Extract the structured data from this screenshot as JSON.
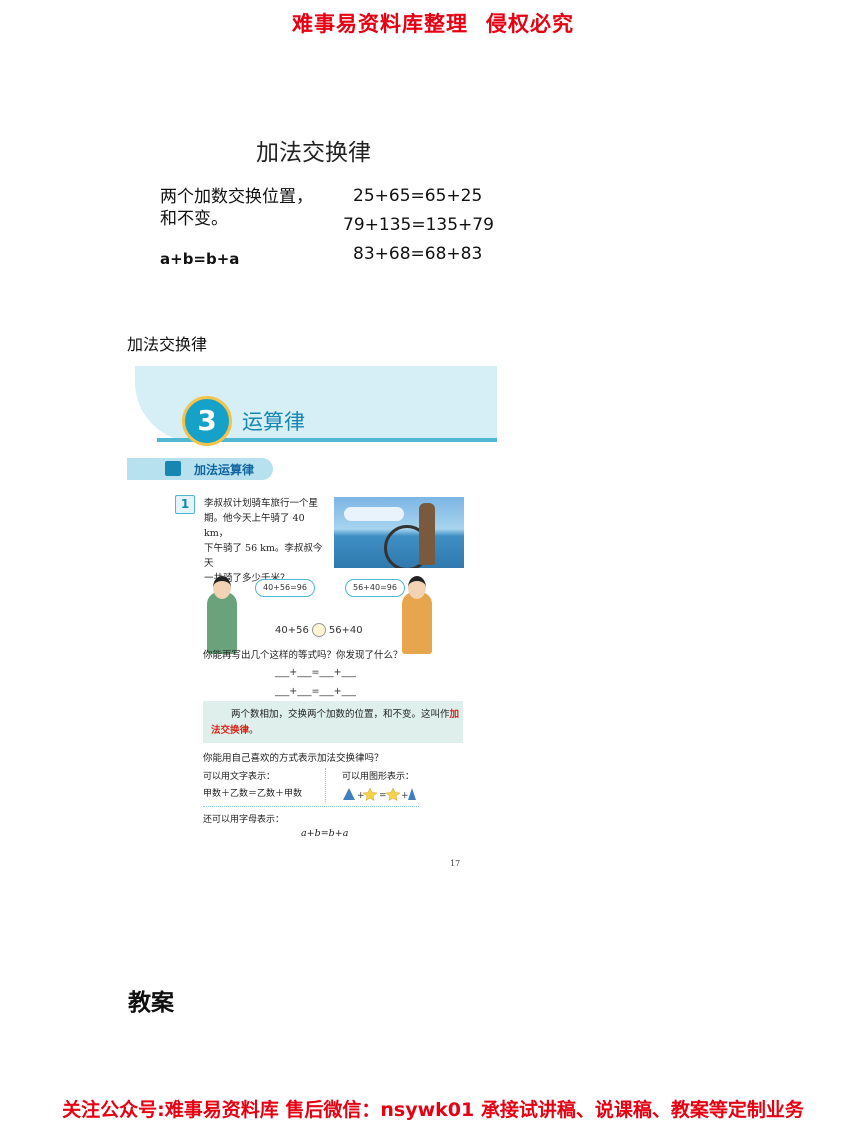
{
  "header": {
    "left": "难事易资料库整理",
    "right": "侵权必究"
  },
  "slide": {
    "title": "加法交换律",
    "rule_line1": "两个加数交换位置，",
    "rule_line2": "和不变。",
    "formula": "a+b=b+a",
    "equations": [
      "25+65=65+25",
      "79+135=135+79",
      "83+68=68+83"
    ]
  },
  "section_caption": "加法交换律",
  "textbook": {
    "unit_number": "3",
    "unit_title": "运算律",
    "topic": "加法运算律",
    "exercise_number": "1",
    "problem_lines": [
      "李叔叔计划骑车旅行一个星",
      "期。他今天上午骑了 40 km，",
      "下午骑了 56 km。李叔叔今天",
      "一共骑了多少千米？"
    ],
    "bubble_boy": "40+56=96",
    "bubble_girl": "56+40=96",
    "compare_left": "40+56",
    "compare_right": "56+40",
    "question1": "你能再写出几个这样的等式吗？你发现了什么？",
    "blank_line": "___+___=___+___",
    "rule_text_before": "两个数相加，交换两个加数的位置，和不变。这叫作",
    "rule_term": "加法交换律",
    "rule_text_after": "。",
    "question2": "你能用自己喜欢的方式表示加法交换律吗？",
    "words_label": "可以用文字表示：",
    "words_expr": "甲数＋乙数＝乙数＋甲数",
    "shapes_label": "可以用图形表示：",
    "letters_label": "还可以用字母表示：",
    "letters_expr": "a+b=b+a",
    "page_number": "17"
  },
  "lesson_heading": "教案",
  "footer": "关注公众号:难事易资料库  售后微信：nsywk01  承接试讲稿、说课稿、教案等定制业务",
  "colors": {
    "banner_red": "#e60012",
    "textbook_blue": "#1787b2",
    "rule_highlight": "#d9251a"
  }
}
